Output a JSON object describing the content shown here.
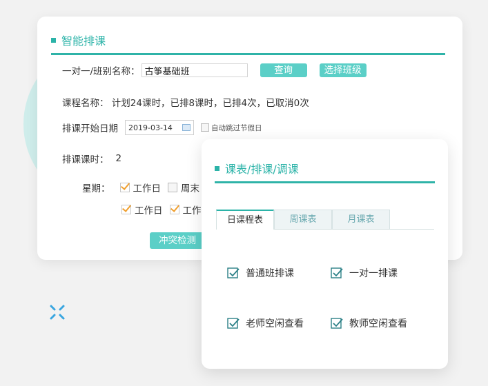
{
  "main": {
    "title": "智能排课",
    "name_label": "一对一/班别名称：",
    "name_value": "古筝基础班",
    "query_button": "查询",
    "select_class_button": "选择班级",
    "course_info": "课程名称： 计划24课时，已排8课时，已排4次，已取消0次",
    "start_date_label": "排课开始日期",
    "start_date_value": "2019-03-14",
    "skip_holiday_label": "自动跳过节假日",
    "hours_label": "排课课时：",
    "hours_value": "2",
    "week_label": "星期：",
    "week_row1": [
      {
        "label": "工作日",
        "checked": true
      },
      {
        "label": "周末",
        "checked": false
      }
    ],
    "week_row2": [
      {
        "label": "工作日",
        "checked": true
      },
      {
        "label": "工作",
        "checked": true
      }
    ],
    "conflict_button": "冲突检测"
  },
  "popup": {
    "title": "课表/排课/调课",
    "tabs": [
      {
        "label": "日课程表",
        "active": true
      },
      {
        "label": "周课表",
        "active": false
      },
      {
        "label": "月课表",
        "active": false
      }
    ],
    "options": [
      {
        "label": "普通班排课",
        "icon": "check-icon"
      },
      {
        "label": "一对一排课",
        "icon": "check-icon"
      },
      {
        "label": "老师空闲查看",
        "icon": "check-icon"
      },
      {
        "label": "教师空闲查看",
        "icon": "check-icon"
      }
    ]
  },
  "colors": {
    "accent": "#2bb3a8",
    "button": "#5bcfc7",
    "check": "#f0a030"
  }
}
